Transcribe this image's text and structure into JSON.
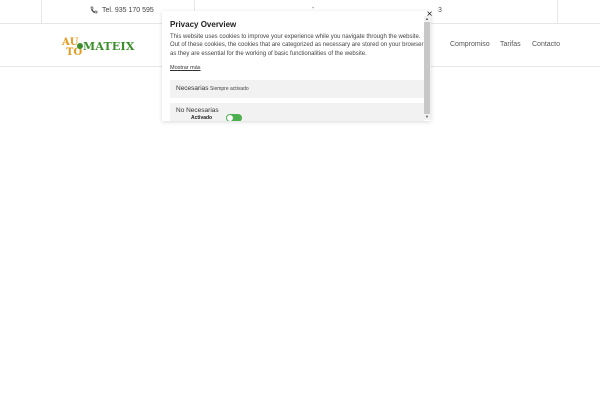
{
  "topbar": {
    "phone": "Tel. 935 170 595",
    "dash": "-",
    "trailing_digit": "3"
  },
  "header": {
    "logo": {
      "part1": "AU",
      "part2": "TO",
      "part3": "MATEIX"
    },
    "nav": [
      {
        "label": "Compromiso"
      },
      {
        "label": "Tarifas"
      },
      {
        "label": "Contacto"
      }
    ]
  },
  "modal": {
    "title": "Privacy Overview",
    "body": "This website uses cookies to improve your experience while you navigate through the website. Out of these cookies, the cookies that are categorized as necessary are stored on your browser as they are essential for the working of basic functionalities of the website.",
    "show_more": "Mostrar más",
    "rows": [
      {
        "label": "Necesarias",
        "sub": "Siempre activado"
      },
      {
        "label": "No Necesarias",
        "toggle_label": "Activado",
        "toggle_on": true
      }
    ],
    "close_symbol": "×"
  },
  "colors": {
    "toggle_on": "#4caf50",
    "logo_orange": "#e49a1c",
    "logo_green": "#3a8f2a"
  }
}
